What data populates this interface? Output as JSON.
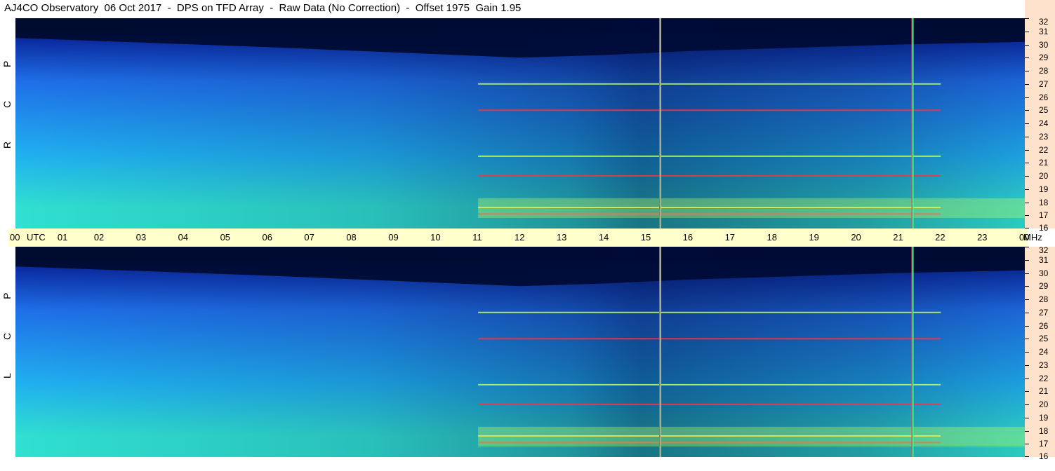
{
  "title": "AJ4CO Observatory  06 Oct 2017  -  DPS on TFD Array  -  Raw Data (No Correction)  -  Offset 1975  Gain 1.95",
  "panels": [
    {
      "id": "rcp",
      "label": "R C P"
    },
    {
      "id": "lcp",
      "label": "L C P"
    }
  ],
  "time_labels": [
    "00",
    "UTC",
    "01",
    "02",
    "03",
    "04",
    "05",
    "06",
    "07",
    "08",
    "09",
    "10",
    "11",
    "12",
    "13",
    "14",
    "15",
    "16",
    "17",
    "18",
    "19",
    "20",
    "21",
    "22",
    "23",
    "00",
    "MHz"
  ],
  "freq_labels": [
    "32",
    "31",
    "30",
    "29",
    "28",
    "27",
    "26",
    "25",
    "24",
    "23",
    "22",
    "21",
    "20",
    "19",
    "18",
    "17",
    "16"
  ],
  "chart_data": {
    "type": "heatmap",
    "x_range_hours_utc": [
      0,
      24
    ],
    "y_range_mhz": [
      16,
      32
    ],
    "y_ticks": [
      16,
      17,
      18,
      19,
      20,
      21,
      22,
      23,
      24,
      25,
      26,
      27,
      28,
      29,
      30,
      31,
      32
    ],
    "x_ticks": [
      "00",
      "01",
      "02",
      "03",
      "04",
      "05",
      "06",
      "07",
      "08",
      "09",
      "10",
      "11",
      "12",
      "13",
      "14",
      "15",
      "16",
      "17",
      "18",
      "19",
      "20",
      "21",
      "22",
      "23",
      "00"
    ],
    "series": [
      {
        "name": "R C P"
      },
      {
        "name": "L C P"
      }
    ],
    "vertical_markers_utc": [
      15.33,
      21.33
    ],
    "interference_bands_mhz": [
      17.1,
      17.6,
      20.0,
      21.5,
      25.0,
      27.0
    ],
    "colormap": [
      "#000c30",
      "#0a2aa0",
      "#1f6fe8",
      "#20b0f0",
      "#30e0d0",
      "#c0ff60",
      "#ffe040",
      "#ff3040"
    ]
  }
}
